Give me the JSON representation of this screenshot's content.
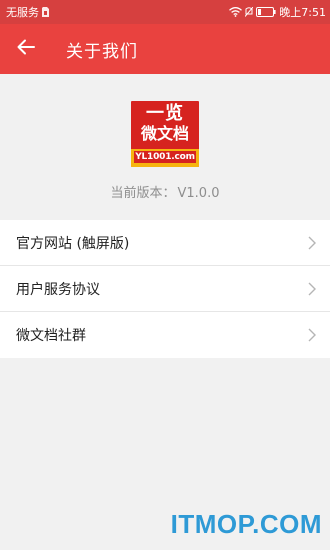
{
  "status_bar": {
    "carrier": "无服务",
    "time_label": "晚上7:51",
    "icons": [
      "sim-icon",
      "wifi-icon",
      "mute-icon",
      "battery-icon"
    ]
  },
  "header": {
    "title": "关于我们",
    "back_icon": "arrow-left-icon"
  },
  "about": {
    "logo_line1": "一览",
    "logo_line2": "微文档",
    "logo_url": "YL1001.com",
    "version_label": "当前版本：",
    "version_value": "V1.0.0"
  },
  "menu": {
    "items": [
      {
        "label": "官方网站 (触屏版)",
        "icon": "chevron-right-icon"
      },
      {
        "label": "用户服务协议",
        "icon": "chevron-right-icon"
      },
      {
        "label": "微文档社群",
        "icon": "chevron-right-icon"
      }
    ]
  },
  "watermark": "ITMOP.COM",
  "colors": {
    "status_bar": "#d6403f",
    "app_bar": "#e9423f",
    "background": "#f1f1f1",
    "logo_red": "#d6231f",
    "logo_yellow": "#f6b40f",
    "watermark": "#2e9ad6"
  }
}
